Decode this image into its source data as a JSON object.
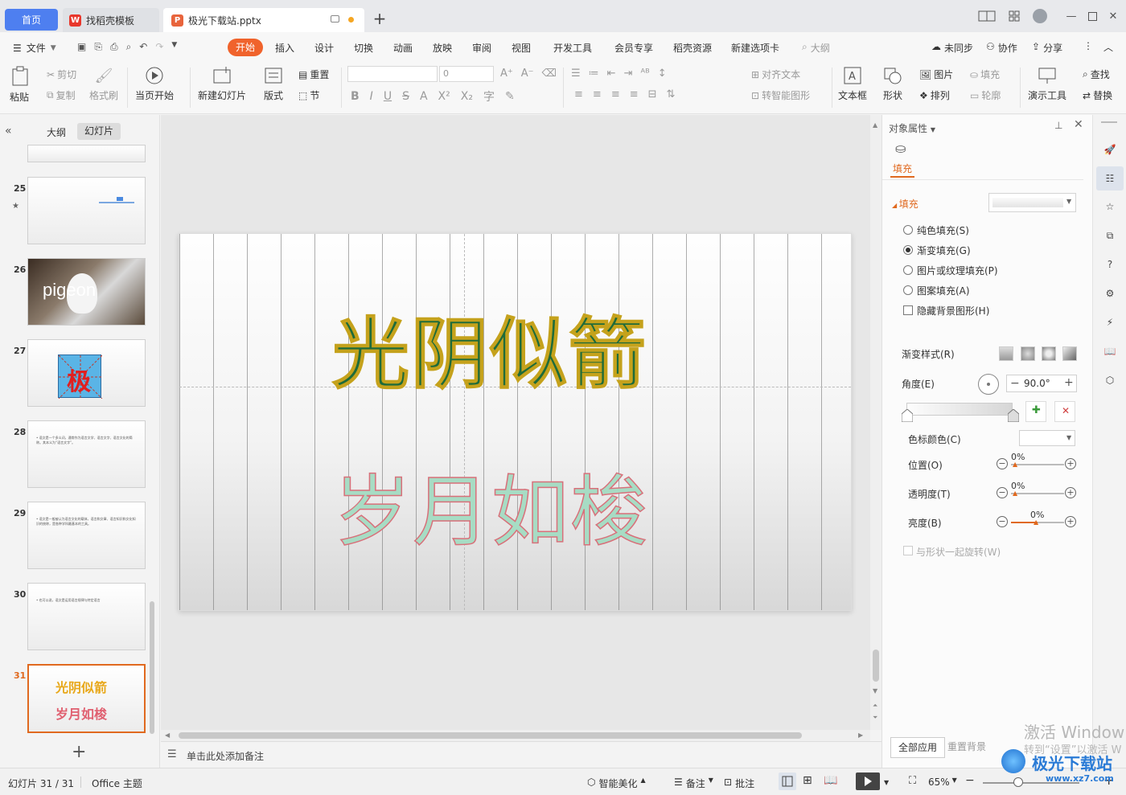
{
  "tabs": {
    "home": "首页",
    "template": "找稻壳模板",
    "file": "极光下载站.pptx"
  },
  "menu": {
    "file": "文件",
    "items": [
      "开始",
      "插入",
      "设计",
      "切换",
      "动画",
      "放映",
      "审阅",
      "视图",
      "开发工具",
      "会员专享",
      "稻壳资源",
      "新建选项卡"
    ],
    "search": "大纲",
    "sync": "未同步",
    "collab": "协作",
    "share": "分享"
  },
  "ribbon": {
    "paste": "粘贴",
    "cut": "剪切",
    "copy": "复制",
    "format_painter": "格式刷",
    "from_current": "当页开始",
    "new_slide": "新建幻灯片",
    "layout": "版式",
    "reset": "重置",
    "section": "节",
    "font_size": "0",
    "align_text": "对齐文本",
    "convert_smartart": "转智能图形",
    "textbox": "文本框",
    "shape": "形状",
    "picture": "图片",
    "arrange": "排列",
    "fill": "填充",
    "outline": "轮廓",
    "presentation_tools": "演示工具",
    "find": "查找",
    "replace": "替换"
  },
  "left_panel": {
    "tab_outline": "大纲",
    "tab_slides": "幻灯片",
    "slides": [
      {
        "num": "25"
      },
      {
        "num": "26",
        "text": "pigeon"
      },
      {
        "num": "27",
        "text": "极"
      },
      {
        "num": "28",
        "text": "• 语文是一个多义词，通常作为语言文学、语言文字、语言文化的简称。其本义为“语言文字”。"
      },
      {
        "num": "29",
        "text": "• 语文是一般被认为语言文化的载体，语言和文章、语言知识和文化知识的统称，是各种学科最基本的工具。"
      },
      {
        "num": "30",
        "text": "• 也可以说，语文是运用语言规律与特定语言"
      },
      {
        "num": "31",
        "line1": "光阴似箭",
        "line2": "岁月如梭"
      }
    ]
  },
  "slide": {
    "line1": "光阴似箭",
    "line2": "岁月如梭"
  },
  "notes_placeholder": "单击此处添加备注",
  "properties": {
    "title": "对象属性",
    "tab_fill": "填充",
    "section_fill": "填充",
    "options": [
      "纯色填充(S)",
      "渐变填充(G)",
      "图片或纹理填充(P)",
      "图案填充(A)"
    ],
    "selected_option": "渐变填充(G)",
    "hide_bg": "隐藏背景图形(H)",
    "gradient_style": "渐变样式(R)",
    "angle_label": "角度(E)",
    "angle_value": "90.0°",
    "stop_color": "色标颜色(C)",
    "position": "位置(O)",
    "position_value": "0%",
    "transparency": "透明度(T)",
    "transparency_value": "0%",
    "brightness": "亮度(B)",
    "brightness_value": "0%",
    "rotate_with_shape": "与形状一起旋转(W)",
    "apply_all": "全部应用",
    "reset_bg": "重置背景"
  },
  "status": {
    "slide_counter": "幻灯片 31 / 31",
    "theme": "Office 主题",
    "smart_beautify": "智能美化",
    "notes": "备注",
    "comments": "批注",
    "zoom": "65%"
  },
  "watermark": {
    "activate": "激活 Window",
    "activate_sub": "转到“设置”以激活 W",
    "site": "极光下载站",
    "url": "www.xz7.com"
  },
  "colors": {
    "accent": "#f0632c",
    "home_tab": "#4e7ff0",
    "title_fill": "#1f6b3a",
    "title_stroke": "#c5a21c",
    "subtitle_fill": "#a7dcc4",
    "subtitle_stroke": "#d8707a"
  }
}
